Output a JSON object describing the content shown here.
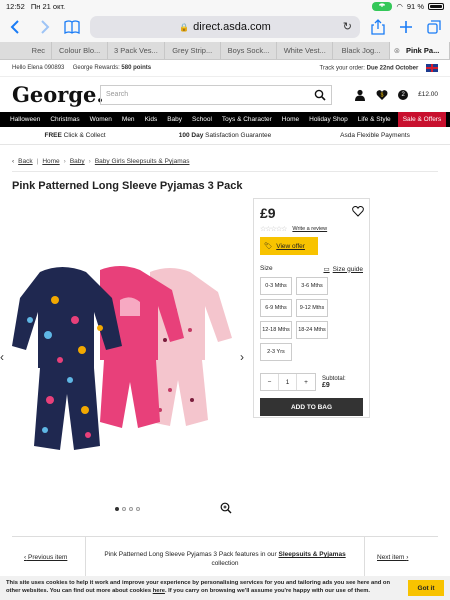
{
  "statusbar": {
    "time": "12:52",
    "date": "Пн 21 окт.",
    "battery": "91 %"
  },
  "browser": {
    "url": "direct.asda.com",
    "tabs": [
      {
        "label": "Rec"
      },
      {
        "label": "Colour Blo..."
      },
      {
        "label": "3 Pack Ves..."
      },
      {
        "label": "Grey Strip..."
      },
      {
        "label": "Boys Sock..."
      },
      {
        "label": "White Vest..."
      },
      {
        "label": "Black Jog..."
      },
      {
        "label": "Pink Pa..."
      }
    ]
  },
  "utility": {
    "greeting": "Hello Elena 090893",
    "rewards_label": "George Rewards:",
    "rewards_points": "580 points",
    "track_label": "Track your order:",
    "track_due": "Due 22nd October"
  },
  "header": {
    "logo": "George.",
    "search_placeholder": "Search",
    "basket_count": "2",
    "basket_total": "£12.00"
  },
  "nav": [
    "Halloween",
    "Christmas",
    "Women",
    "Men",
    "Kids",
    "Baby",
    "School",
    "Toys & Character",
    "Home",
    "Holiday Shop",
    "Life & Style",
    "Sale & Offers"
  ],
  "promo": {
    "p1_bold": "FREE",
    "p1_rest": "Click & Collect",
    "p2_bold": "100 Day",
    "p2_rest": "Satisfaction Guarantee",
    "p3": "Asda Flexible Payments"
  },
  "breadcrumb": {
    "back": "Back",
    "home": "Home",
    "baby": "Baby",
    "current": "Baby Girls Sleepsuits & Pyjamas"
  },
  "product": {
    "title": "Pink Patterned Long Sleeve Pyjamas 3 Pack",
    "price": "£9",
    "write_review": "Write a review",
    "view_offer": "View offer",
    "size_label": "Size",
    "size_guide": "Size guide",
    "sizes": [
      "0-3 Mths",
      "3-6 Mths",
      "6-9 Mths",
      "9-12 Mths",
      "12-18 Mths",
      "18-24 Mths",
      "2-3 Yrs"
    ],
    "qty": "1",
    "subtotal_label": "Subtotal:",
    "subtotal_value": "£9",
    "add_to_bag": "ADD TO BAG"
  },
  "pager": {
    "prev": "Previous item",
    "next": "Next item",
    "mid_text": "Pink Patterned Long Sleeve Pyjamas 3 Pack features in our",
    "mid_link": "Sleepsuits & Pyjamas",
    "mid_end": "collection"
  },
  "cookie": {
    "text1": "This site uses cookies to help it work and improve your experience by personalising services for you and tailoring ads you see here and on other websites. You can find out more about cookies",
    "link": "here",
    "text2": ". If you carry on browsing we'll assume you're happy with our use of them.",
    "button": "Got it"
  },
  "colors": {
    "accent": "#f8c300",
    "sale": "#c8102e",
    "nav_bg": "#000000",
    "link_blue": "#1a7cf6"
  }
}
